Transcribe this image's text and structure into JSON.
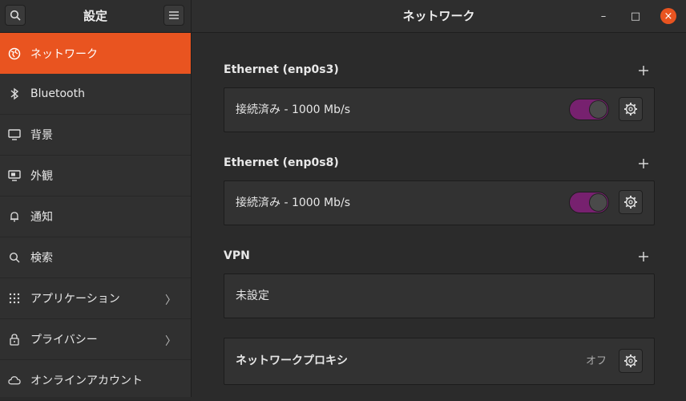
{
  "sidebar": {
    "title": "設定",
    "items": [
      {
        "label": "ネットワーク",
        "icon": "network-globe-icon",
        "active": true
      },
      {
        "label": "Bluetooth",
        "icon": "bluetooth-icon"
      },
      {
        "label": "背景",
        "icon": "background-display-icon"
      },
      {
        "label": "外観",
        "icon": "appearance-icon"
      },
      {
        "label": "通知",
        "icon": "bell-icon"
      },
      {
        "label": "検索",
        "icon": "search-icon"
      },
      {
        "label": "アプリケーション",
        "icon": "apps-grid-icon",
        "chevron": "〉"
      },
      {
        "label": "プライバシー",
        "icon": "lock-icon",
        "chevron": "〉"
      },
      {
        "label": "オンラインアカウント",
        "icon": "cloud-icon"
      }
    ]
  },
  "window": {
    "title": "ネットワーク",
    "minimize": "–",
    "maximize": "□",
    "close": "×"
  },
  "sections": [
    {
      "title": "Ethernet (enp0s3)",
      "status": "接続済み - 1000 Mb/s",
      "toggle_on": true
    },
    {
      "title": "Ethernet (enp0s8)",
      "status": "接続済み - 1000 Mb/s",
      "toggle_on": true
    },
    {
      "title": "VPN",
      "status": "未設定"
    }
  ],
  "proxy": {
    "label": "ネットワークプロキシ",
    "state": "オフ"
  },
  "colors": {
    "accent": "#e95420",
    "toggle_on": "#77216f",
    "background": "#2b2b2b"
  }
}
